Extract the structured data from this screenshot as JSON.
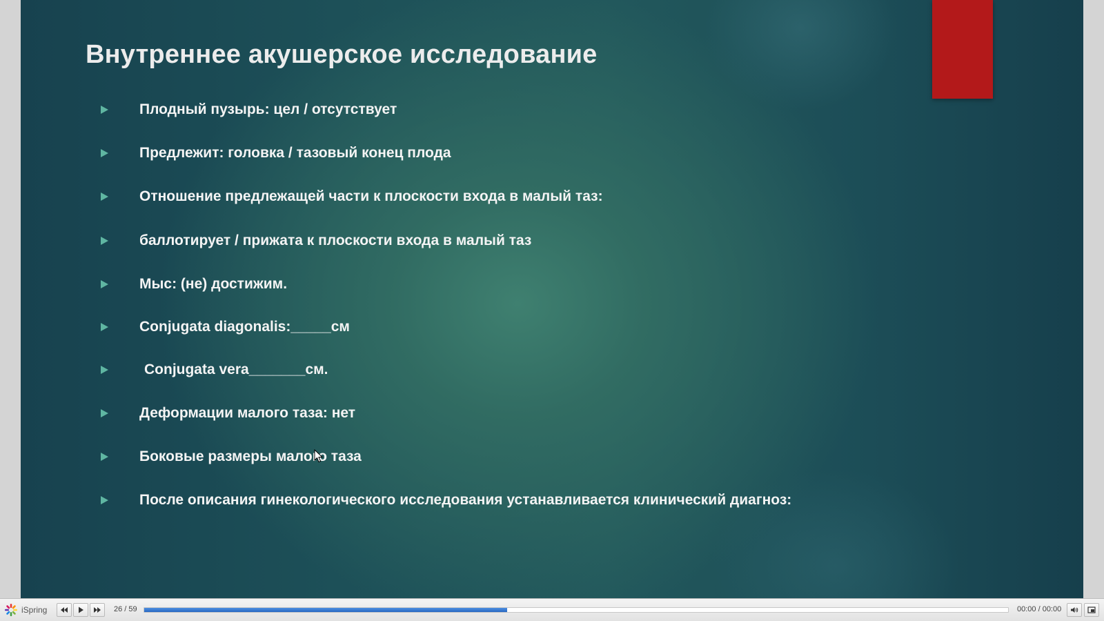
{
  "slide": {
    "title": "Внутреннее акушерское исследование",
    "bullets": [
      "Плодный пузырь: цел / отсутствует",
      "Предлежит: головка / тазовый конец плода",
      "Отношение предлежащей части к плоскости входа в малый таз:",
      "баллотирует / прижата к плоскости входа в малый таз",
      "Мыс: (не) достижим.",
      "Conjugata diagonalis:_____см",
      "Conjugata vera_______см.",
      "Деформации малого таза: нет",
      "Боковые размеры малого таза",
      "После описания гинекологического исследования устанавливается клинический диагноз:"
    ],
    "colors": {
      "accent_block": "#b3191a",
      "bullet_arrow": "#5fb6a2",
      "text": "#f4f4f4"
    }
  },
  "player": {
    "brand": "iSpring",
    "slide_counter": "26 / 59",
    "progress": 0.42,
    "time": "00:00 / 00:00",
    "icons": {
      "logo": "ispring-logo-icon",
      "prev": "rewind-icon",
      "play": "play-icon",
      "next": "fast-forward-icon",
      "volume": "volume-icon",
      "fullscreen": "fullscreen-icon"
    }
  }
}
